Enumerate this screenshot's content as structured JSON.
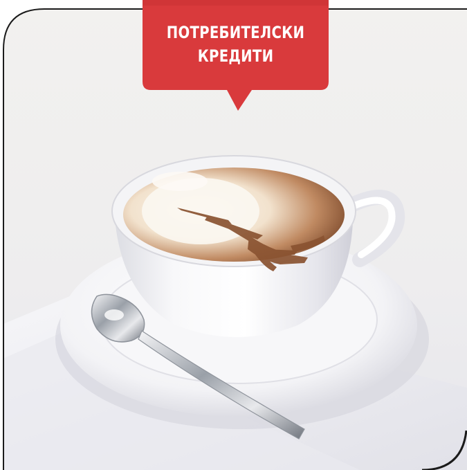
{
  "banner": {
    "line1": "ПОТРЕБИТЕЛСКИ",
    "line2": "КРЕДИТИ",
    "color": "#d93a3c"
  },
  "photo": {
    "subject": "cappuccino-cup-with-eiffel-tower-latte-art",
    "accent_colors": [
      "#8a5331",
      "#f7efe6",
      "#ffffff"
    ]
  }
}
